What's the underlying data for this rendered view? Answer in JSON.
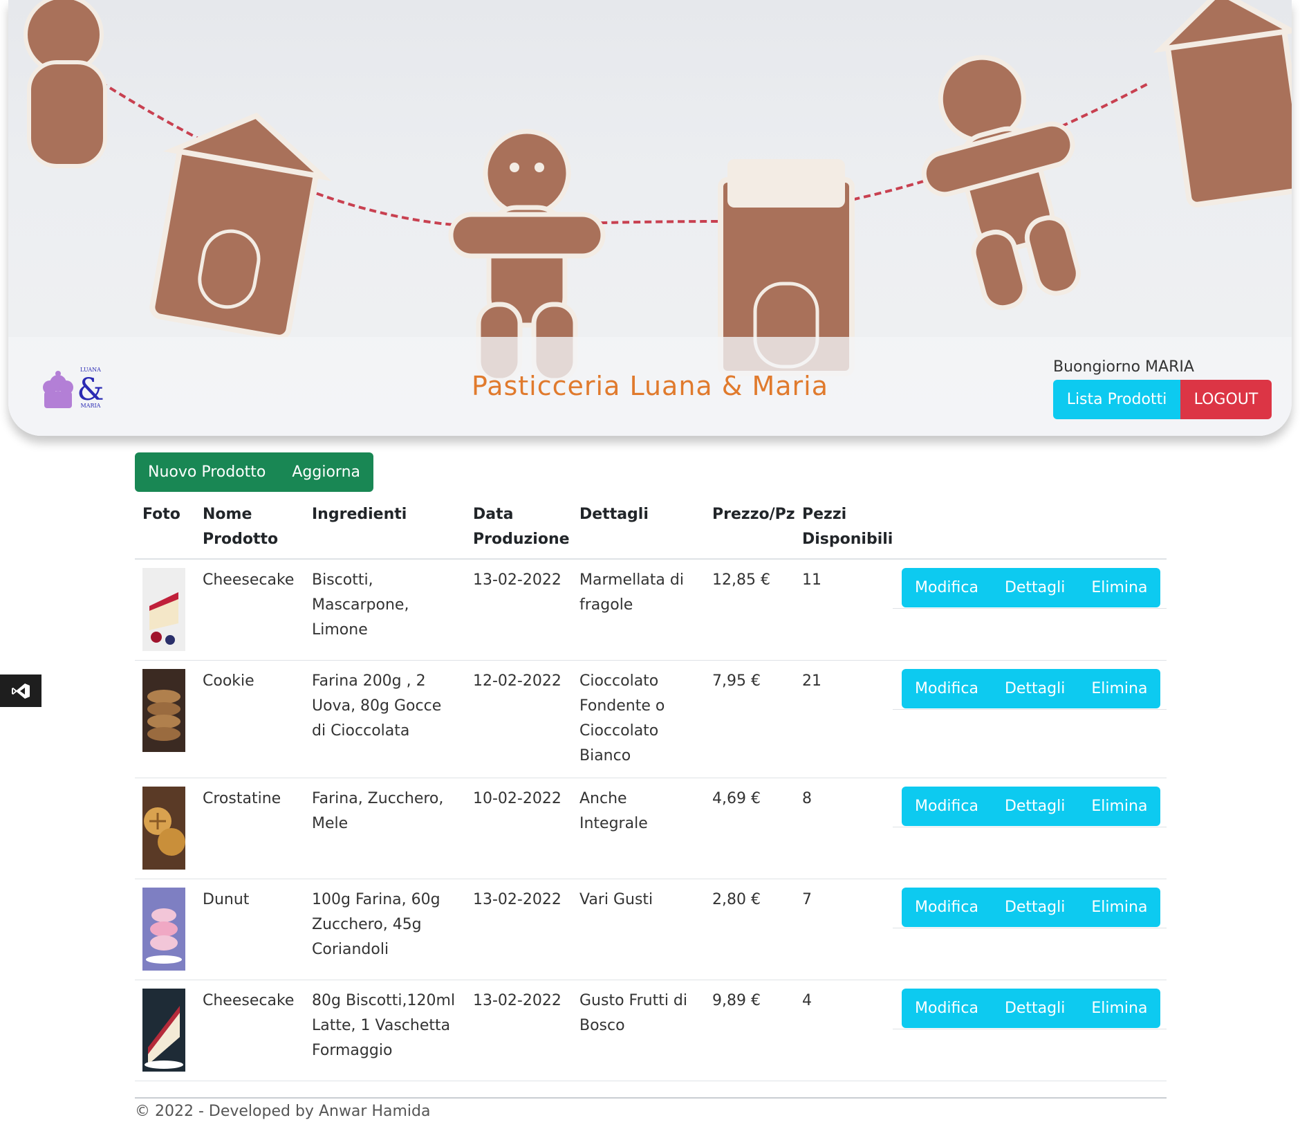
{
  "header": {
    "brand_title": "Pasticceria Luana & Maria",
    "greeting": "Buongiorno MARIA",
    "nav": {
      "list_label": "Lista Prodotti",
      "logout_label": "LOGOUT"
    },
    "logo": {
      "icon": "cupcake-icon",
      "text_top": "LUANA",
      "ampersand": "&",
      "text_bottom": "MARIA"
    }
  },
  "toolbar": {
    "new_label": "Nuovo Prodotto",
    "refresh_label": "Aggiorna"
  },
  "table": {
    "headers": {
      "photo": "Foto",
      "name": "Nome Prodotto",
      "ingredients": "Ingredienti",
      "date": "Data Produzione",
      "details": "Dettagli",
      "price": "Prezzo/Pz",
      "stock": "Pezzi Disponibili"
    },
    "actions": {
      "edit": "Modifica",
      "details": "Dettagli",
      "delete": "Elimina"
    },
    "rows": [
      {
        "name": "Cheesecake",
        "ingredients": "Biscotti, Mascarpone, Limone",
        "date": "13-02-2022",
        "details": "Marmellata di fragole",
        "price": "12,85 €",
        "stock": "11"
      },
      {
        "name": "Cookie",
        "ingredients": "Farina 200g , 2 Uova, 80g Gocce di Cioccolata",
        "date": "12-02-2022",
        "details": "Cioccolato Fondente o Cioccolato Bianco",
        "price": "7,95 €",
        "stock": "21"
      },
      {
        "name": "Crostatine",
        "ingredients": "Farina, Zucchero, Mele",
        "date": "10-02-2022",
        "details": "Anche Integrale",
        "price": "4,69 €",
        "stock": "8"
      },
      {
        "name": "Dunut",
        "ingredients": "100g Farina, 60g Zucchero, 45g Coriandoli",
        "date": "13-02-2022",
        "details": "Vari Gusti",
        "price": "2,80 €",
        "stock": "7"
      },
      {
        "name": "Cheesecake",
        "ingredients": "80g Biscotti,120ml Latte, 1 Vaschetta Formaggio",
        "date": "13-02-2022",
        "details": "Gusto Frutti di Bosco",
        "price": "9,89 €",
        "stock": "4"
      }
    ]
  },
  "footer": {
    "text": "© 2022 - Developed by Anwar Hamida"
  },
  "side_widget": {
    "icon": "visual-studio-icon"
  },
  "colors": {
    "cyan": "#0dcaf0",
    "red": "#dc3545",
    "green": "#198754",
    "brand": "#e07a2d"
  }
}
